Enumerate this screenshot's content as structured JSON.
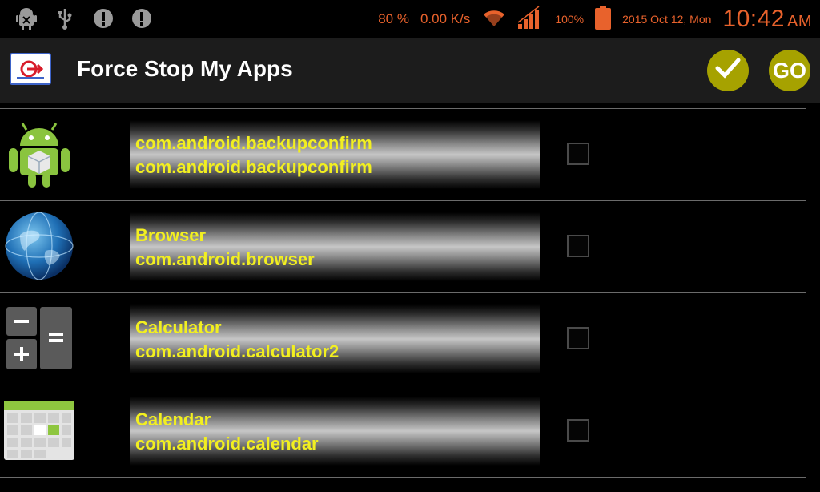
{
  "status_bar": {
    "left_icons": [
      "android-debug-icon",
      "usb-icon",
      "warning-icon",
      "warning-icon"
    ],
    "battery_percent_text": "80 %",
    "net_speed": "0.00 K/s",
    "signal_percent": "100%",
    "date": "2015 Oct 12, Mon",
    "time": "10:42",
    "ampm": "AM"
  },
  "action_bar": {
    "title": "Force Stop My Apps",
    "go_label": "GO"
  },
  "apps": [
    {
      "title": "com.android.backupconfirm",
      "package": "com.android.backupconfirm",
      "icon": "android-robot-icon",
      "checked": false
    },
    {
      "title": "Browser",
      "package": "com.android.browser",
      "icon": "globe-icon",
      "checked": false
    },
    {
      "title": "Calculator",
      "package": "com.android.calculator2",
      "icon": "calculator-icon",
      "checked": false
    },
    {
      "title": "Calendar",
      "package": "com.android.calendar",
      "icon": "calendar-icon",
      "checked": false
    }
  ],
  "colors": {
    "status_text": "#e8622c",
    "label_text": "#f2ef20",
    "action_button": "#a6a200",
    "action_bar_bg": "#1c1c1c"
  }
}
